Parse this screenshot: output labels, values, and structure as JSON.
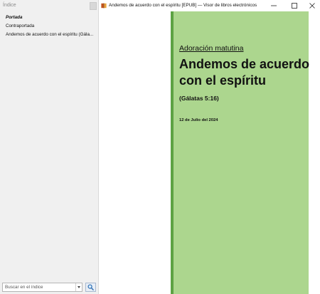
{
  "window": {
    "title": "Andemos de acuerdo con el espíritu [EPUB] — Visor de libros electrónicos",
    "app_icon": "book-icon",
    "controls": [
      "minimize-icon",
      "maximize-icon",
      "close-icon"
    ]
  },
  "sidebar": {
    "title": "Índice",
    "items": [
      {
        "label": "Portada",
        "active": true
      },
      {
        "label": "Contraportada",
        "active": false
      },
      {
        "label": "Andemos de acuerdo con el espíritu (Gála...",
        "active": false
      }
    ],
    "search": {
      "placeholder": "Buscar en el índice",
      "value": "",
      "button_icon": "search-icon"
    }
  },
  "page": {
    "subtitle": "Adoración matutina",
    "title": "Andemos de acuerdo con el espíritu",
    "reference": "(Gálatas 5:16)",
    "date": "12 de Julio del 2024",
    "background_color": "#acd68e",
    "border_color": "#5da244"
  }
}
